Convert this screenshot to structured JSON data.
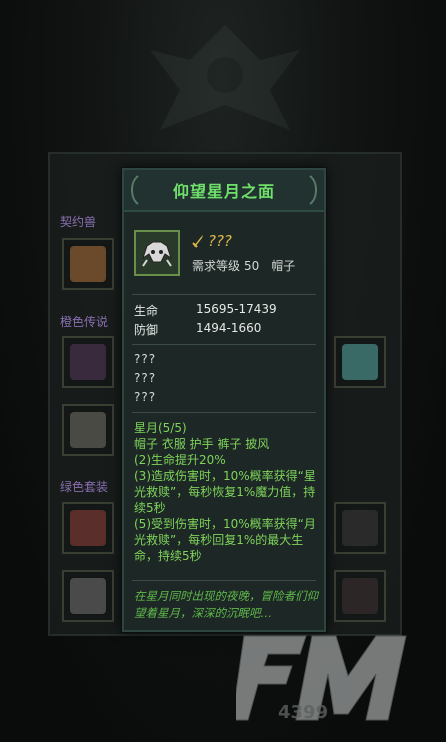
{
  "tooltip": {
    "title": "仰望星月之面",
    "item_name": "???",
    "req_label": "需求等级",
    "req_level": "50",
    "slot": "帽子",
    "stats": [
      {
        "label": "生命",
        "value": "15695-17439"
      },
      {
        "label": "防御",
        "value": "1494-1660"
      }
    ],
    "unknown_lines": [
      "???",
      "???",
      "???"
    ],
    "set_lines": [
      "星月(5/5)",
      "帽子 衣服 护手 裤子 披风",
      "(2)生命提升20%",
      "(3)造成伤害时，10%概率获得“星光救赎”，每秒恢复1%魔力值，持续5秒",
      "(5)受到伤害时，10%概率获得“月光救赎”，每秒回复1%的最大生命，持续5秒"
    ],
    "lore": "在星月同时出现的夜晚，冒险者们仰望着星月，深深的沉眠吧…"
  },
  "background": {
    "sections": [
      "契约兽",
      "橙色传说",
      "绿色套装"
    ]
  },
  "colors": {
    "title_green": "#6fe06a",
    "name_gold": "#d9b54a",
    "set_green": "#7fd35a",
    "panel_bg": "#1d2826"
  },
  "watermark": {
    "brand": "FM",
    "sub": "4399"
  }
}
